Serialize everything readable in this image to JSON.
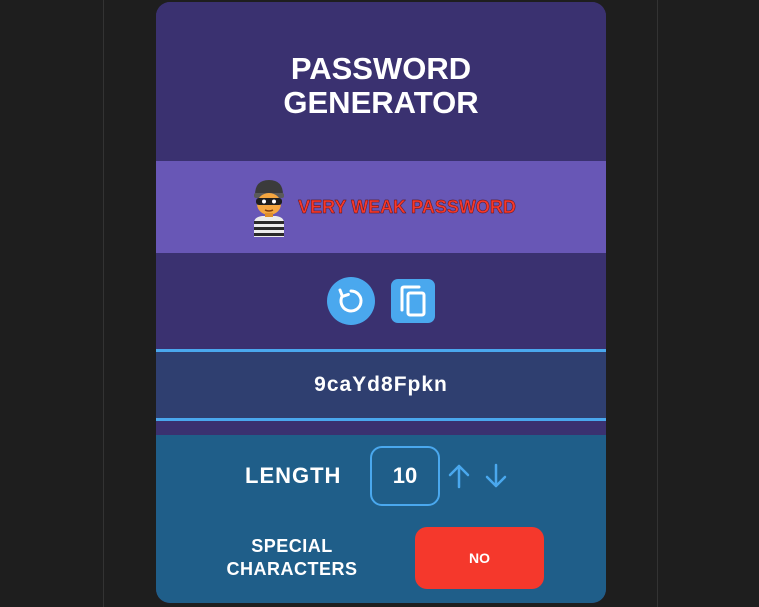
{
  "app": {
    "title": "PASSWORD GENERATOR"
  },
  "strength": {
    "label": "VERY WEAK PASSWORD",
    "icon": "thief-avatar-icon",
    "color": "#f5382c"
  },
  "actions": {
    "refresh_icon": "refresh-icon",
    "copy_icon": "copy-icon"
  },
  "password": {
    "value": "9caYd8Fpkn"
  },
  "settings": {
    "length_label": "LENGTH",
    "length_value": "10",
    "special_label": "SPECIAL CHARACTERS",
    "special_value": "NO"
  },
  "colors": {
    "background": "#1e1e1e",
    "card": "#3a3170",
    "strength_band": "#6857b6",
    "accent": "#4aa8ee",
    "settings_panel": "#1f5e89",
    "toggle_off": "#f5382c"
  }
}
